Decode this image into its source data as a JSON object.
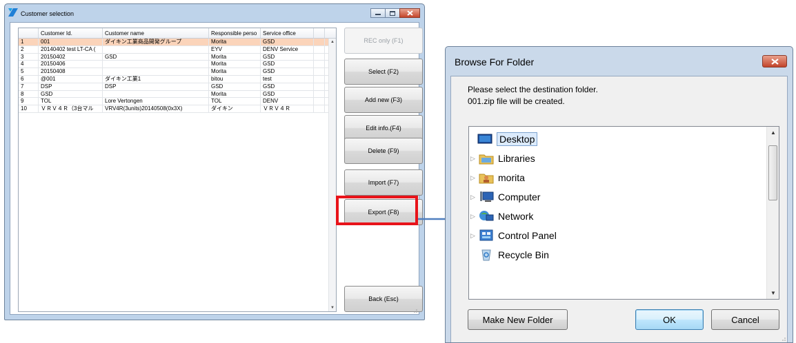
{
  "customer_window": {
    "title": "Customer selection",
    "columns": [
      "Customer Id.",
      "Customer name",
      "Responsible perso",
      "Service office",
      ""
    ],
    "rows": [
      {
        "no": "1",
        "id": "001",
        "name": "ダイキン工業商品開発グループ",
        "responsible": "Morita",
        "office": "GSD",
        "selected": true
      },
      {
        "no": "2",
        "id": "20140402 test LT-CA (",
        "name": "",
        "responsible": "EYV",
        "office": "DENV Service"
      },
      {
        "no": "3",
        "id": "20150402",
        "name": "GSD",
        "responsible": "Morita",
        "office": "GSD"
      },
      {
        "no": "4",
        "id": "20150406",
        "name": "",
        "responsible": "Morita",
        "office": "GSD"
      },
      {
        "no": "5",
        "id": "20150408",
        "name": "",
        "responsible": "Morita",
        "office": "GSD"
      },
      {
        "no": "6",
        "id": "@001",
        "name": "ダイキン工業1",
        "responsible": "bitou",
        "office": "test"
      },
      {
        "no": "7",
        "id": "DSP",
        "name": "DSP",
        "responsible": "GSD",
        "office": "GSD"
      },
      {
        "no": "8",
        "id": "GSD",
        "name": "",
        "responsible": "Morita",
        "office": "GSD"
      },
      {
        "no": "9",
        "id": "TOL",
        "name": "Lore Vertongen",
        "responsible": "TOL",
        "office": "DENV"
      },
      {
        "no": "10",
        "id": "ＶＲＶ４Ｒ（3台マル",
        "name": "VRV4R(3units)20140508(0x3X)",
        "responsible": "ダイキン",
        "office": "ＶＲＶ４Ｒ"
      }
    ],
    "buttons": {
      "rec_only": "REC only (F1)",
      "select": "Select (F2)",
      "add_new": "Add new (F3)",
      "edit_info": "Edit info.(F4)",
      "delete": "Delete (F9)",
      "import": "Import (F7)",
      "export": "Export (F8)",
      "back": "Back (Esc)"
    }
  },
  "browse_dialog": {
    "title": "Browse For Folder",
    "message_line1": "Please select the destination folder.",
    "message_line2": "001.zip file will be created.",
    "tree": [
      {
        "label": "Desktop",
        "icon": "desktop-icon",
        "selected": true
      },
      {
        "label": "Libraries",
        "icon": "libraries-folder-icon"
      },
      {
        "label": "morita",
        "icon": "user-folder-icon"
      },
      {
        "label": "Computer",
        "icon": "computer-icon"
      },
      {
        "label": "Network",
        "icon": "network-icon"
      },
      {
        "label": "Control Panel",
        "icon": "control-panel-icon"
      },
      {
        "label": "Recycle Bin",
        "icon": "recycle-bin-icon"
      }
    ],
    "buttons": {
      "make_new_folder": "Make New Folder",
      "ok": "OK",
      "cancel": "Cancel"
    }
  },
  "colors": {
    "selected_row": "#fbd4ba",
    "highlight": "#e8131a",
    "arrow": "#4f7fbf"
  }
}
